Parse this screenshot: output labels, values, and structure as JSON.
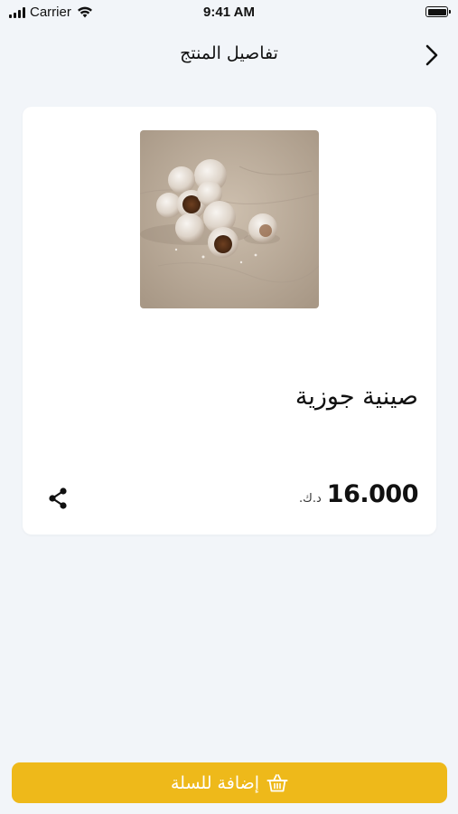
{
  "status_bar": {
    "carrier": "Carrier",
    "time": "9:41 AM"
  },
  "header": {
    "title": "تفاصيل المنتج",
    "back_icon": "chevron-right-icon"
  },
  "product": {
    "name": "صينية جوزية",
    "price": "16.000",
    "currency": "د.ك.",
    "share_icon": "share-icon"
  },
  "footer": {
    "add_to_cart_label": "إضافة للسلة",
    "basket_icon": "basket-icon",
    "button_color": "#eeb91a"
  }
}
